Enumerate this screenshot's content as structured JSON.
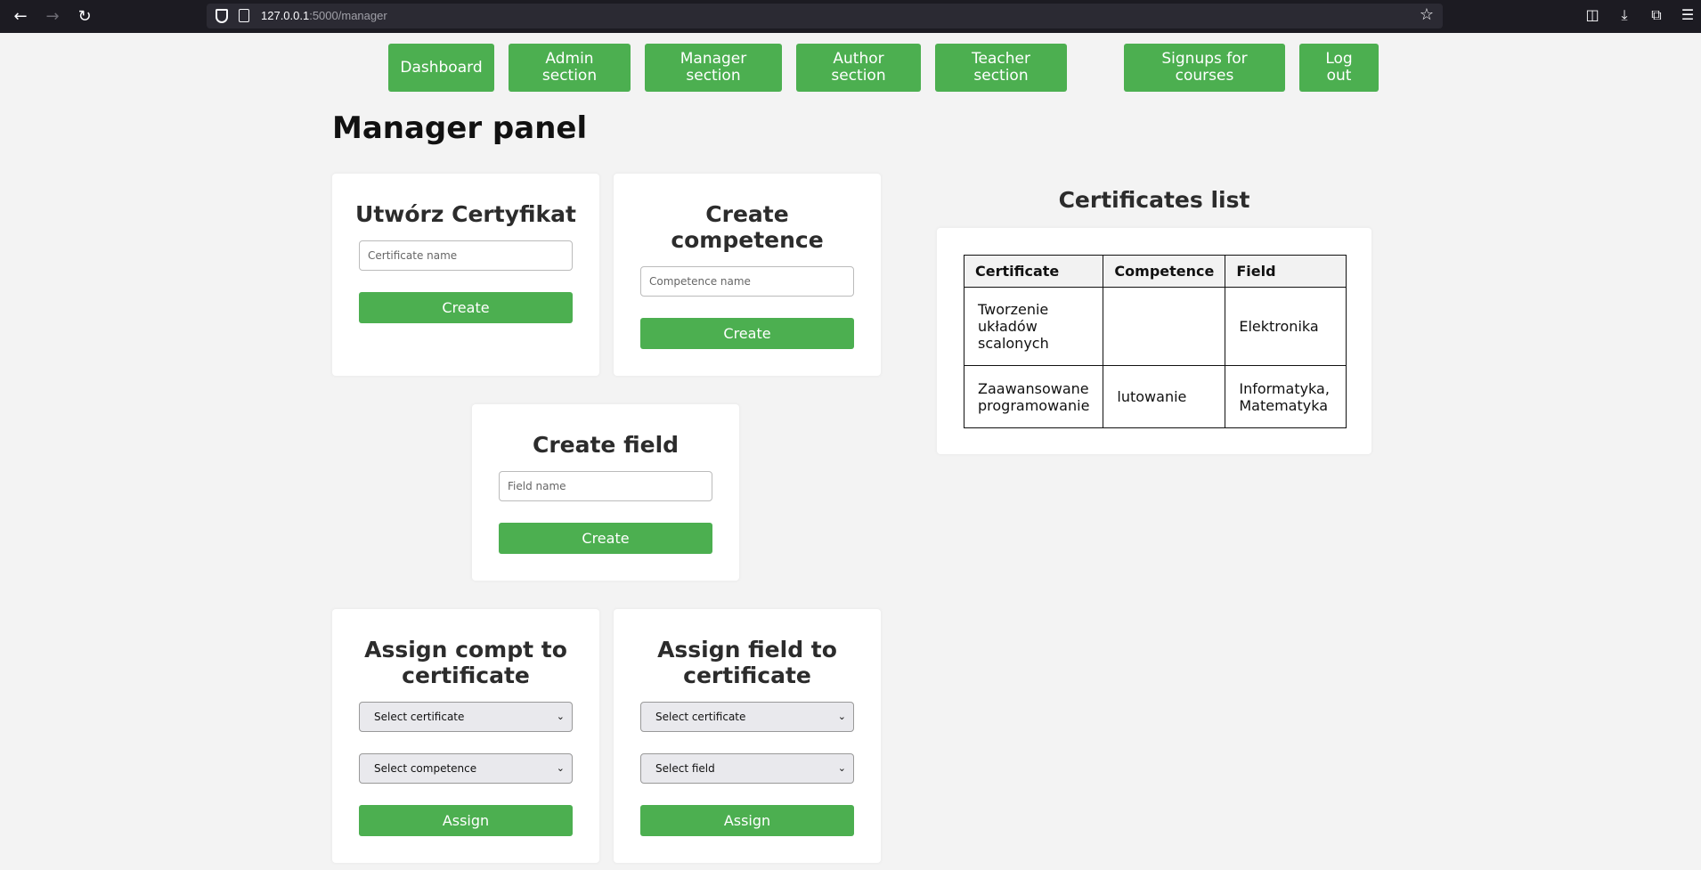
{
  "browser": {
    "url_host": "127.0.0.1",
    "url_path": ":5000/manager",
    "icons": [
      "back-icon",
      "forward-icon",
      "reload-icon",
      "shield-icon",
      "page-icon",
      "star-icon",
      "pocket-icon",
      "download-icon",
      "extensions-icon",
      "menu-icon"
    ]
  },
  "nav": {
    "dashboard": "Dashboard",
    "admin": [
      "Admin",
      "section"
    ],
    "manager": [
      "Manager",
      "section"
    ],
    "author": [
      "Author",
      "section"
    ],
    "teacher": [
      "Teacher",
      "section"
    ],
    "signups": [
      "Signups for",
      "courses"
    ],
    "logout": [
      "Log",
      "out"
    ]
  },
  "page_title": "Manager panel",
  "create_certificate": {
    "title": "Utwórz Certyfikat",
    "placeholder": "Certificate name",
    "button": "Create"
  },
  "create_competence": {
    "title": [
      "Create",
      "competence"
    ],
    "placeholder": "Competence name",
    "button": "Create"
  },
  "create_field": {
    "title": "Create field",
    "placeholder": "Field name",
    "button": "Create"
  },
  "assign_compt": {
    "title": [
      "Assign compt to",
      "certificate"
    ],
    "select_certificate": "Select certificate",
    "select_competence": "Select competence",
    "button": "Assign"
  },
  "assign_field": {
    "title": [
      "Assign field to",
      "certificate"
    ],
    "select_certificate": "Select certificate",
    "select_field": "Select field",
    "button": "Assign"
  },
  "certificates_list": {
    "title": "Certificates list",
    "headers": [
      "Certificate",
      "Competence",
      "Field"
    ],
    "rows": [
      [
        [
          "Tworzenie",
          "układów",
          "scalonych"
        ],
        [
          ""
        ],
        [
          "Elektronika"
        ]
      ],
      [
        [
          "Zaawansowane",
          "programowanie"
        ],
        [
          "lutowanie"
        ],
        [
          "Informatyka,",
          "Matematyka"
        ]
      ]
    ]
  },
  "colors": {
    "accent": "#4caf50",
    "background": "#f3f3f3",
    "card": "#ffffff",
    "browser_bar": "#1c1b22"
  }
}
